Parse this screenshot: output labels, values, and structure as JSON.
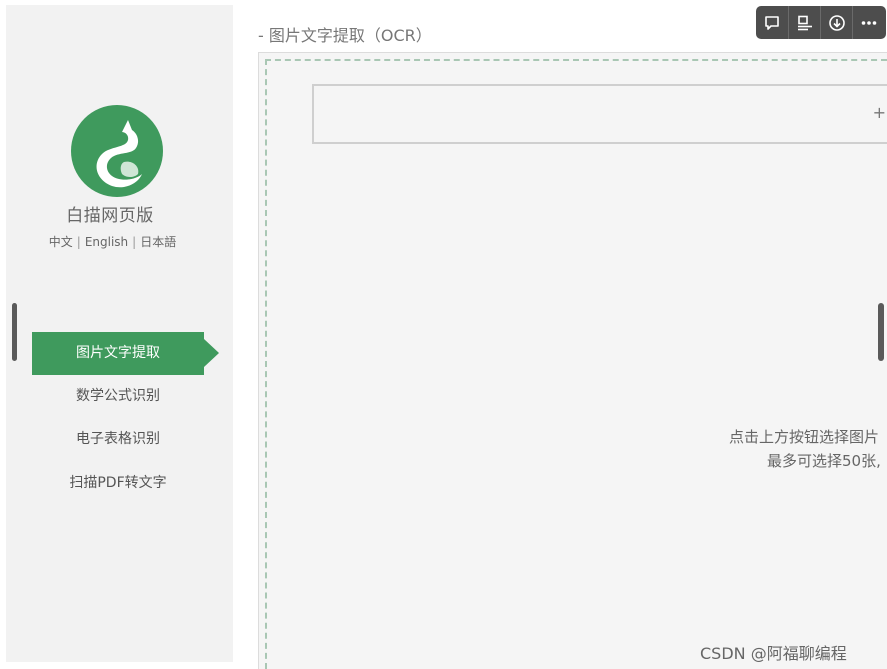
{
  "app": {
    "name": "白描网页版",
    "brand_color": "#3f9a5d"
  },
  "languages": [
    "中文",
    "English",
    "日本語"
  ],
  "nav": {
    "items": [
      {
        "label": "图片文字提取",
        "active": true
      },
      {
        "label": "数学公式识别",
        "active": false
      },
      {
        "label": "电子表格识别",
        "active": false
      },
      {
        "label": "扫描PDF转文字",
        "active": false
      }
    ]
  },
  "main": {
    "title": "- 图片文字提取（OCR）",
    "upload_icon": "plus-icon",
    "hint_line1": "点击上方按钮选择图片",
    "hint_line2": "最多可选择50张,"
  },
  "toolbar": {
    "icons": [
      "comment-icon",
      "text-layout-icon",
      "download-icon",
      "more-icon"
    ]
  },
  "watermark": "CSDN @阿福聊编程"
}
